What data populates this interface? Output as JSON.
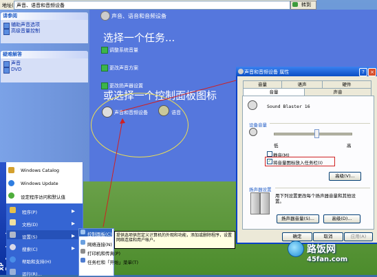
{
  "address_bar": {
    "label": "地址(D)",
    "value": "声音、语音和音频设备",
    "go_label": "转到"
  },
  "taskpane": {
    "see_also": {
      "title": "请参阅",
      "links": [
        "辅助声音选项",
        "高级音量控制"
      ]
    },
    "troubleshoot": {
      "title": "疑难解答",
      "links": [
        "声音",
        "DVD"
      ]
    }
  },
  "main": {
    "title": "声音、语音和音频设备",
    "pick_task": "选择一个任务...",
    "tasks": [
      "调整系统音量",
      "更改声音方案",
      "更改扬声器设置"
    ],
    "pick_icon": "或选择一个控制面板图标",
    "icons": [
      "声音和音频设备",
      "语音"
    ]
  },
  "dialog": {
    "title": "声音和音频设备 属性",
    "help_btn": "?",
    "close_btn": "×",
    "tabs_row1": [
      "音量",
      "语声",
      "硬件"
    ],
    "tabs_row2": [
      "音量",
      "声音"
    ],
    "device_name": "Sound Blaster 16",
    "device_volume_group": "设备音量",
    "low": "低",
    "high": "高",
    "mute_label": "静音(M)",
    "mute_checked": false,
    "tray_label": "将音量图标放入任务栏(I)",
    "tray_checked": true,
    "advanced_btn": "高级(V)...",
    "speaker_group": "扬声器设置",
    "speaker_desc": "用下列设置更改每个扬声器音量和其他设置。",
    "speaker_volume_btn": "扬声器音量(S)...",
    "speaker_advanced_btn": "高级(D)...",
    "ok_btn": "确定",
    "cancel_btn": "取消",
    "apply_btn": "应用(A)",
    "volume_level": 0.55
  },
  "start_menu": {
    "band_text": "XP Professional",
    "top_items": [
      "Windows Catalog",
      "Windows Update",
      "设定程序访问和默认值"
    ],
    "lower_items": [
      "程序(P)",
      "文档(D)",
      "设置(S)",
      "搜索(C)",
      "帮助和支持(H)",
      "运行(R)..."
    ],
    "submenu": [
      "控制面板(C)",
      "网络连接(N)",
      "打印机和传真(P)",
      "任务栏和「开始」菜单(T)"
    ],
    "tooltip": "提供选项供您定义计算机的外观和功能，添加或删除程序，设置网络连接和用户帐户。"
  },
  "watermark": {
    "name": "路饭网",
    "url": "45fan.com"
  }
}
